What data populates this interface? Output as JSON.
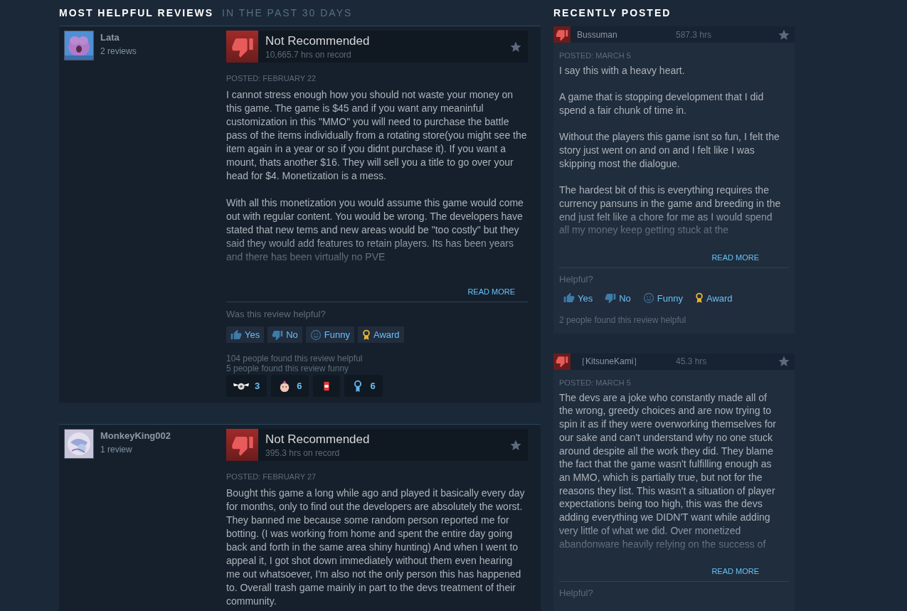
{
  "main_heading": "MOST HELPFUL REVIEWS",
  "main_subheading": "IN THE PAST 30 DAYS",
  "helpful_reviews": [
    {
      "author": "Lata",
      "review_count": "2 reviews",
      "recommended": false,
      "verdict": "Not Recommended",
      "hours": "10,665.7 hrs on record",
      "posted": "POSTED: FEBRUARY 22",
      "truncated": true,
      "paragraphs": [
        "I cannot stress enough how you should not waste your money on this game. The game is $45 and if you want any meaninful customization in this \"MMO\" you will need to purchase the battle pass of the items individually from a rotating store(you might see the item again in a year or so if you didnt purchase it). If you want a mount, thats another $16. They will sell you a title to go over your head for $4. Monetization is a mess.",
        "With all this monetization you would assume this game would come out with regular content. You would be wrong. The developers have stated that new tems and new areas would be \"too costly\" but they said they would add features to retain players. Its has been years and there has been virtually no PVE"
      ],
      "read_more": "READ MORE",
      "helpful_prompt": "Was this review helpful?",
      "buttons": [
        {
          "kind": "yes",
          "label": "Yes"
        },
        {
          "kind": "no",
          "label": "No"
        },
        {
          "kind": "funny",
          "label": "Funny"
        },
        {
          "kind": "award",
          "label": "Award"
        }
      ],
      "stats": [
        "104 people found this review helpful",
        "5 people found this review funny"
      ],
      "awards": [
        {
          "kind": "wings",
          "count": "3"
        },
        {
          "kind": "baby",
          "count": "6"
        },
        {
          "kind": "can"
        },
        {
          "kind": "ribbon",
          "count": "6"
        }
      ]
    },
    {
      "author": "MonkeyKing002",
      "review_count": "1 review",
      "recommended": false,
      "verdict": "Not Recommended",
      "hours": "395.3 hrs on record",
      "posted": "POSTED: FEBRUARY 27",
      "truncated": false,
      "paragraphs": [
        "Bought this game a long while ago and played it basically every day for months, only to find out the developers are absolutely the worst. They banned me because some random person reported me for botting. (I was working from home and spent the entire day going back and forth in the same area shiny hunting) And when I went to appeal it, I got shot down immediately without them even hearing me out whatsoever, I'm also not the only person this has happened to. Overall trash game mainly in part to the devs treatment of their community."
      ]
    }
  ],
  "recent_heading": "RECENTLY POSTED",
  "recent_reviews": [
    {
      "author": "Bussuman",
      "hours": "587.3 hrs",
      "recommended": false,
      "posted": "POSTED: MARCH 5",
      "truncated": true,
      "paragraphs": [
        "I say this with a heavy heart.",
        "A game that is stopping development that I did spend a fair chunk of time in.",
        "Without the players this game isnt so fun, I felt the story just went on and on and I felt like I was skipping most the dialogue.",
        "The hardest bit of this is everything requires the currency pansuns in the game and breeding in the end just felt like a chore for me as I would spend all my money keep getting stuck at the"
      ],
      "read_more": "READ MORE",
      "helpful_prompt": "Helpful?",
      "buttons": [
        {
          "kind": "yes",
          "label": "Yes"
        },
        {
          "kind": "no",
          "label": "No"
        },
        {
          "kind": "funny",
          "label": "Funny"
        },
        {
          "kind": "award",
          "label": "Award"
        }
      ],
      "stats": [
        "2 people found this review helpful"
      ]
    },
    {
      "author": "［KitsuneKami］",
      "hours": "45.3 hrs",
      "recommended": false,
      "posted": "POSTED: MARCH 5",
      "truncated": true,
      "paragraphs": [
        "The devs are a joke who constantly made all of the wrong, greedy choices and are now trying to spin it as if they were overworking themselves for our sake and can't understand why no one stuck around despite all the work they did. They blame the fact that the game wasn't fulfilling enough as an MMO, which is partially true, but not for the reasons they list. This wasn't a situation of player expectations being too high, this was the devs adding everything we DIDN'T want while adding very little of what we did. Over monetized abandonware heavily relying on the success of"
      ],
      "read_more": "READ MORE",
      "helpful_prompt": "Helpful?"
    }
  ]
}
